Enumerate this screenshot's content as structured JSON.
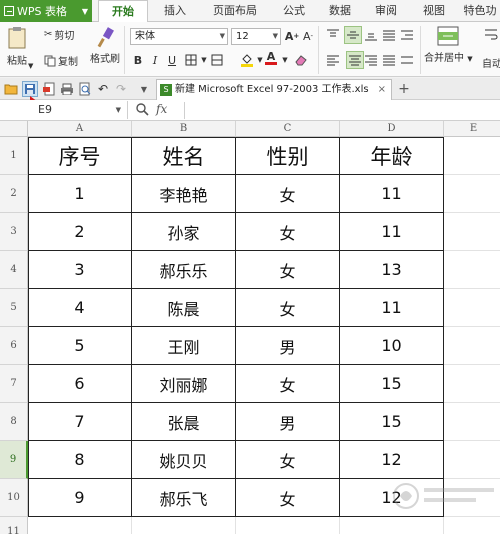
{
  "app": {
    "name": "WPS 表格"
  },
  "menu": {
    "tabs": [
      {
        "label": "开始",
        "active": true
      },
      {
        "label": "插入"
      },
      {
        "label": "页面布局"
      },
      {
        "label": "公式"
      },
      {
        "label": "数据"
      },
      {
        "label": "审阅"
      },
      {
        "label": "视图"
      },
      {
        "label": "特色功"
      }
    ]
  },
  "ribbon": {
    "paste": "粘贴",
    "cut": "剪切",
    "copy": "复制",
    "format_painter": "格式刷",
    "font_name": "宋体",
    "font_size": "12",
    "bold": "B",
    "italic": "I",
    "underline": "U",
    "merge_center": "合并居中",
    "auto_wrap": "自动"
  },
  "document": {
    "tab_title": "新建 Microsoft Excel 97-2003 工作表.xls",
    "close": "×",
    "new_tab": "+"
  },
  "formula_bar": {
    "cell_ref": "E9",
    "fx": "fx"
  },
  "sheet": {
    "columns": [
      "A",
      "B",
      "C",
      "D",
      "E"
    ],
    "row_numbers": [
      "1",
      "2",
      "3",
      "4",
      "5",
      "6",
      "7",
      "8",
      "9",
      "10",
      "11"
    ],
    "selected_row": "9",
    "header": [
      "序号",
      "姓名",
      "性别",
      "年龄"
    ],
    "rows": [
      [
        "1",
        "李艳艳",
        "女",
        "11"
      ],
      [
        "2",
        "孙家",
        "女",
        "11"
      ],
      [
        "3",
        "郝乐乐",
        "女",
        "13"
      ],
      [
        "4",
        "陈晨",
        "女",
        "11"
      ],
      [
        "5",
        "王刚",
        "男",
        "10"
      ],
      [
        "6",
        "刘丽娜",
        "女",
        "15"
      ],
      [
        "7",
        "张晨",
        "男",
        "15"
      ],
      [
        "8",
        "姚贝贝",
        "女",
        "12"
      ],
      [
        "9",
        "郝乐飞",
        "女",
        "12"
      ]
    ]
  },
  "colors": {
    "accent": "#4a9a2f",
    "annotation_arrow": "#d8191c"
  }
}
